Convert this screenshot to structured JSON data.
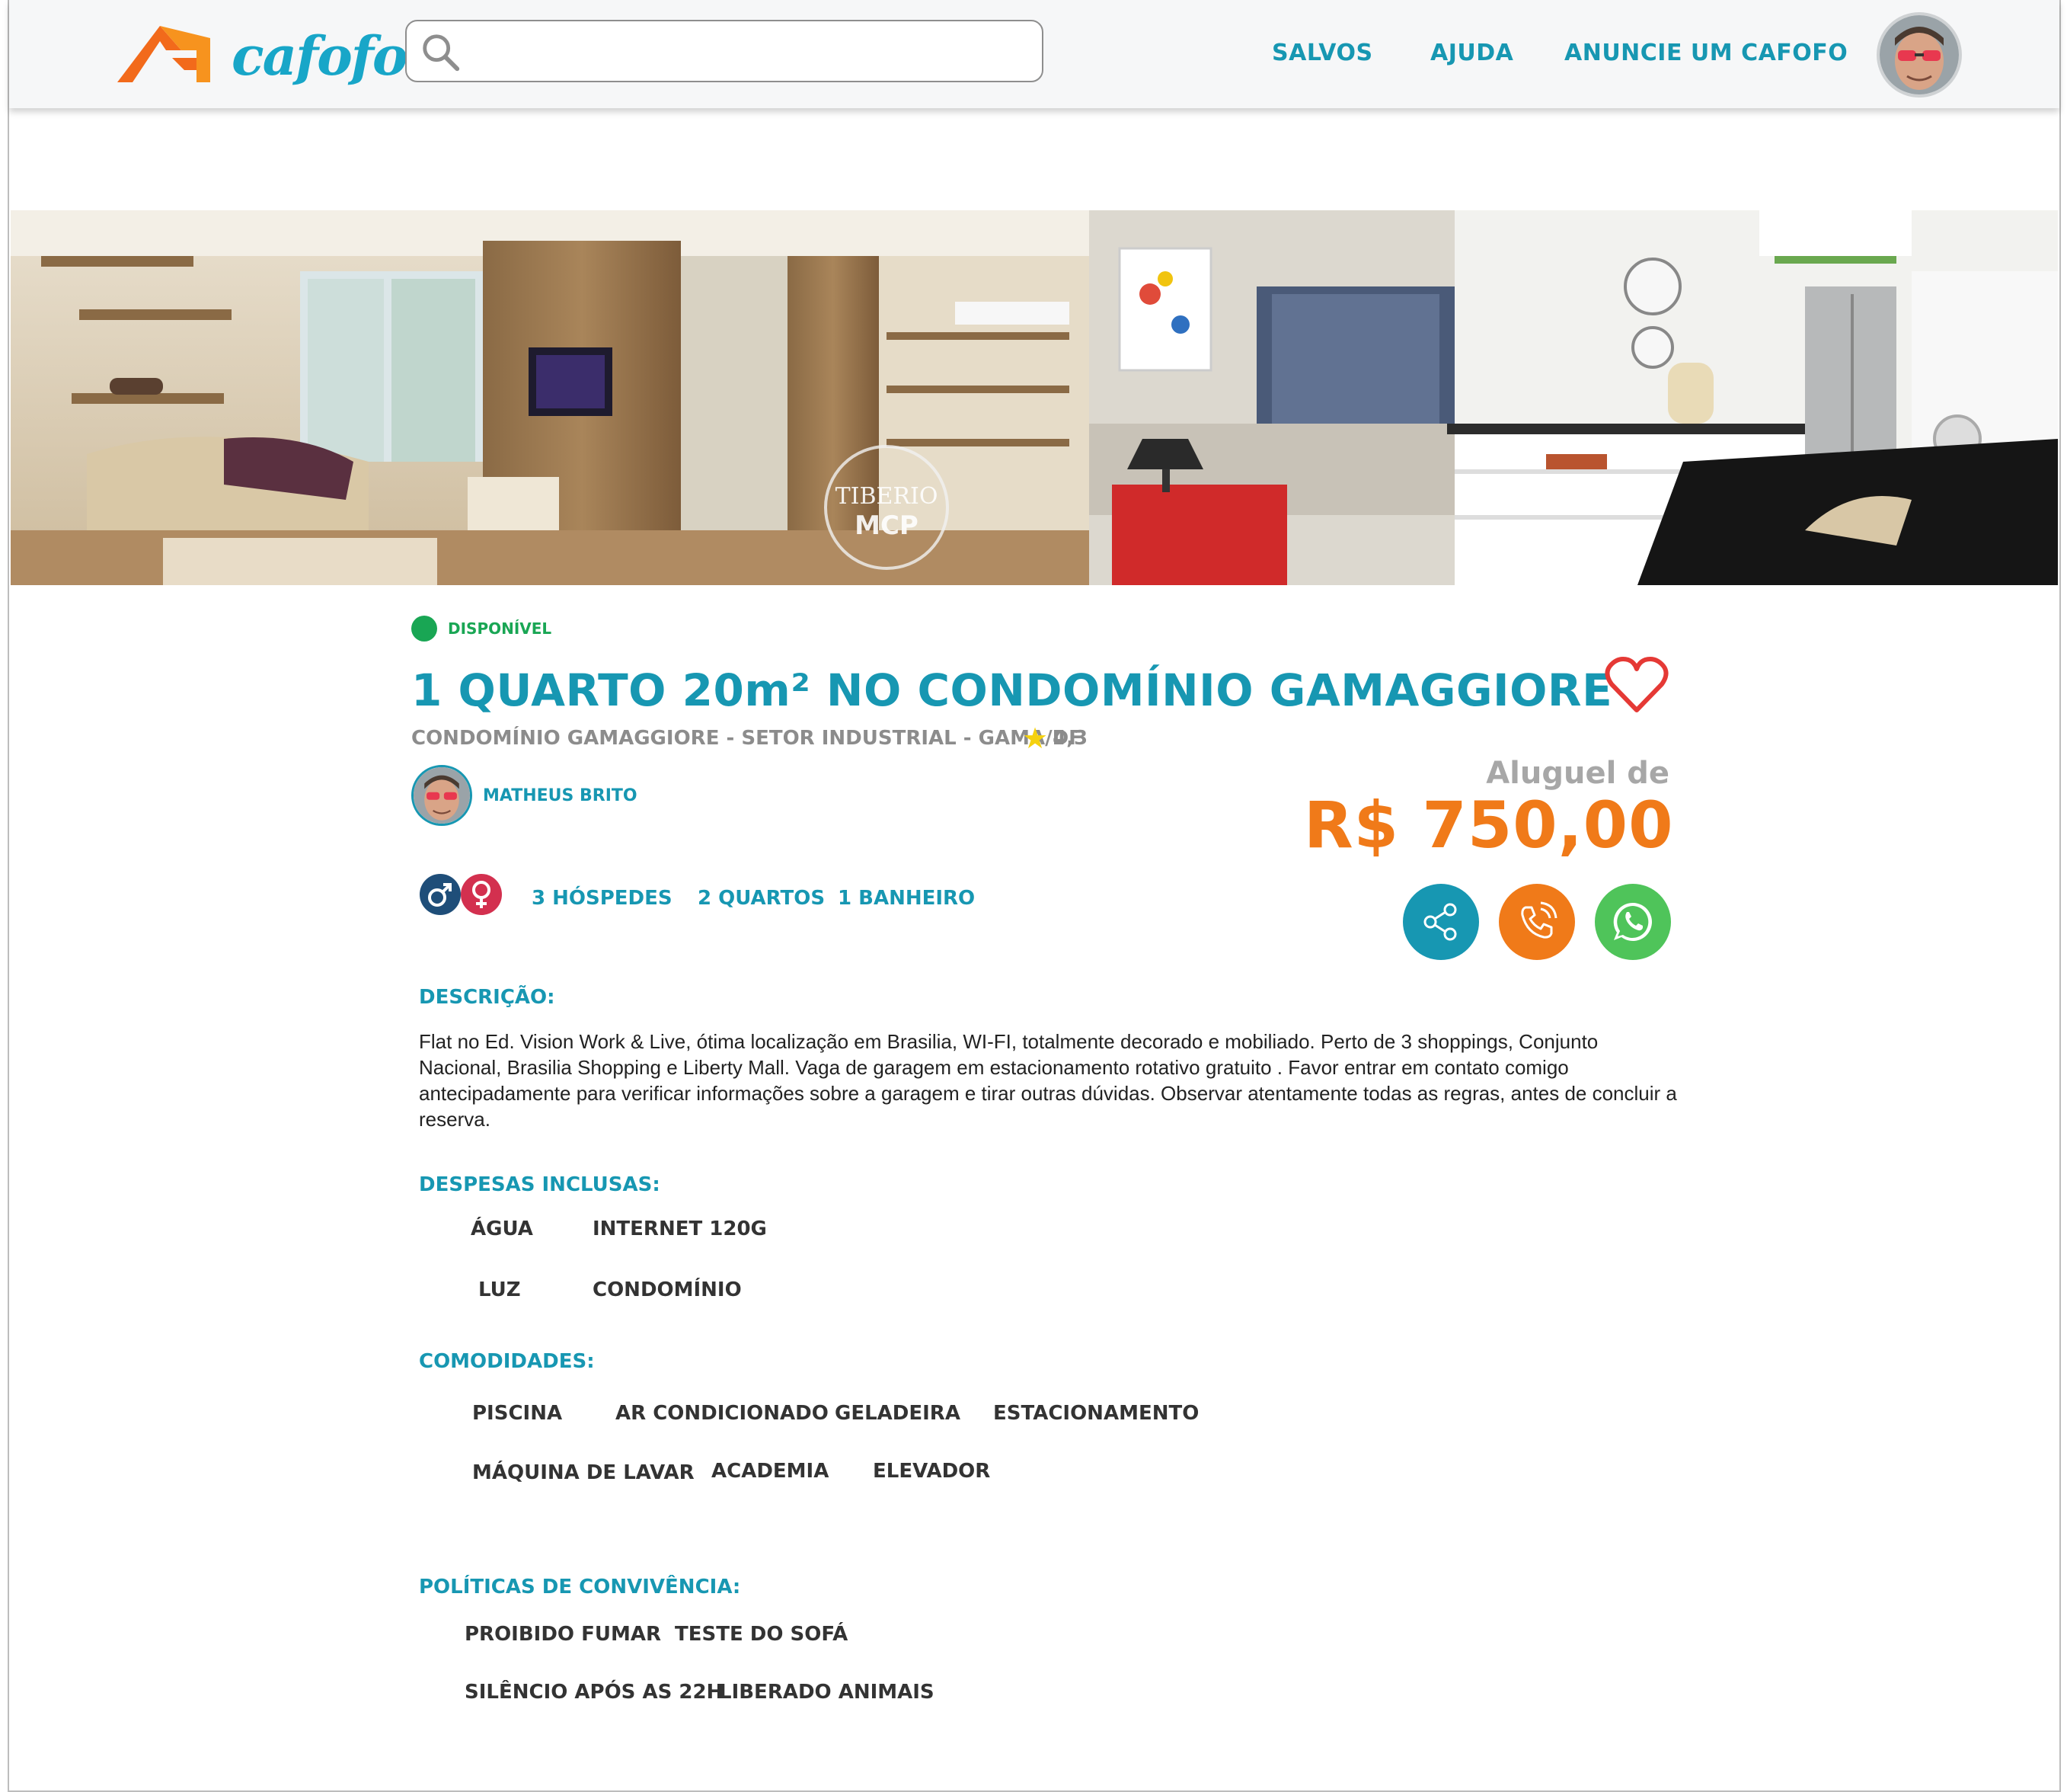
{
  "header": {
    "logo_text": "cafofo",
    "search": {
      "value": "",
      "placeholder": ""
    },
    "nav": [
      "SALVOS",
      "AJUDA",
      "ANUNCIE UM CAFOFO"
    ]
  },
  "listing": {
    "status": "DISPONÍVEL",
    "title": "1 QUARTO 20m² NO CONDOMÍNIO GAMAGGIORE",
    "location": "CONDOMÍNIO GAMAGGIORE -  SETOR INDUSTRIAL - GAMA/DF",
    "rating": "4,3",
    "host_name": "MATHEUS BRITO",
    "price_label": "Aluguel de",
    "price": "R$ 750,00",
    "features": [
      "3 HÓSPEDES",
      "2 QUARTOS",
      "1 BANHEIRO"
    ],
    "watermark_1": "TIBERIO",
    "watermark_2": "MCP"
  },
  "description": {
    "title": "DESCRIÇÃO:",
    "text": "Flat no Ed. Vision Work & Live, ótima localização em Brasilia, WI-FI, totalmente decorado e mobiliado. Perto de 3 shoppings, Conjunto Nacional, Brasilia Shopping e Liberty Mall. Vaga de garagem em estacionamento rotativo gratuito . Favor entrar em contato comigo antecipadamente para verificar informações sobre a garagem e tirar outras dúvidas. Observar atentamente todas as regras, antes de concluir a reserva."
  },
  "expenses": {
    "title": "DESPESAS INCLUSAS:",
    "items": [
      "ÁGUA",
      "INTERNET 120G",
      "LUZ",
      "CONDOMÍNIO"
    ]
  },
  "amenities": {
    "title": "COMODIDADES:",
    "items": [
      "PISCINA",
      "AR CONDICIONADO",
      "GELADEIRA",
      "ESTACIONAMENTO",
      "MÁQUINA DE LAVAR",
      "ACADEMIA",
      "ELEVADOR"
    ]
  },
  "policies": {
    "title": "POLÍTICAS DE CONVIVÊNCIA:",
    "items": [
      "PROIBIDO FUMAR",
      "TESTE DO SOFÁ",
      "SILÊNCIO APÓS AS 22H",
      "LIBERADO ANIMAIS"
    ]
  },
  "colors": {
    "brand_teal": "#1797b2",
    "brand_orange": "#f07a19",
    "available_green": "#19a654",
    "whatsapp_green": "#4fc45a",
    "heart_red": "#e53935"
  },
  "icons": [
    "logo-house-icon",
    "search-icon",
    "heart-icon",
    "star-icon",
    "male-icon",
    "female-icon",
    "share-icon",
    "phone-icon",
    "whatsapp-icon"
  ]
}
